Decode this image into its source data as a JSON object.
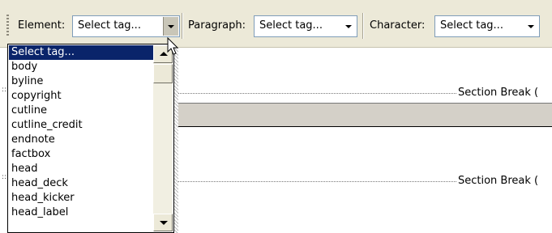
{
  "toolbar": {
    "element_label": "Element:",
    "element_value": "Select tag...",
    "paragraph_label": "Paragraph:",
    "paragraph_value": "Select tag...",
    "character_label": "Character:",
    "character_value": "Select tag..."
  },
  "dropdown": {
    "items": [
      "Select tag...",
      "body",
      "byline",
      "copyright",
      "cutline",
      "cutline_credit",
      "endnote",
      "factbox",
      "head",
      "head_deck",
      "head_kicker",
      "head_label"
    ],
    "selected_index": 0
  },
  "document": {
    "section_break_1": "Section Break (",
    "section_break_2": "Section Break ("
  },
  "colors": {
    "toolbar_bg": "#ece9d8",
    "selection_bg": "#0a246a",
    "band_gray": "#d4d0c8"
  },
  "icons": [
    "dropdown-arrow-icon",
    "scroll-up-arrow-icon",
    "scroll-down-arrow-icon",
    "mouse-pointer-icon",
    "paragraph-mark-icon"
  ]
}
